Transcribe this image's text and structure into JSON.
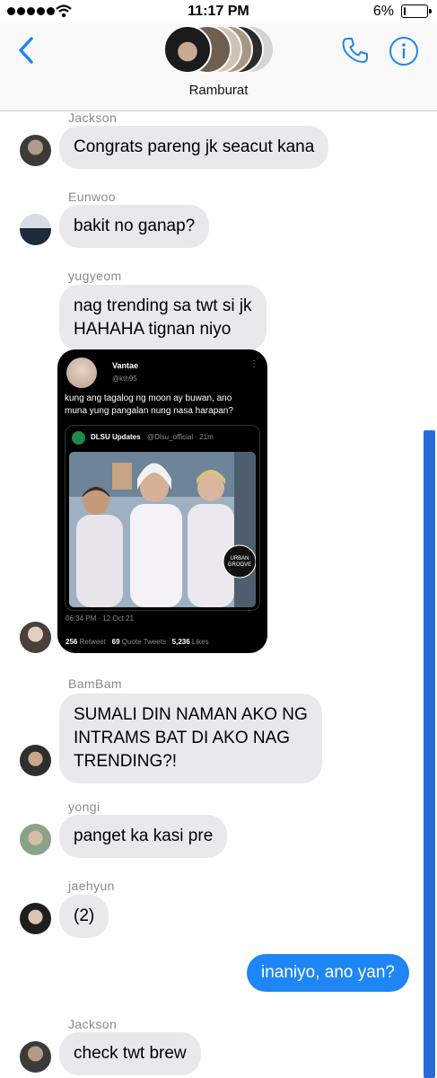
{
  "status": {
    "time": "11:17 PM",
    "battery": "6%",
    "battery_level": 0.06
  },
  "header": {
    "title": "Ramburat"
  },
  "messages": [
    {
      "sender": "Jackson",
      "text": "Congrats pareng jk seacut kana"
    },
    {
      "sender": "Eunwoo",
      "text": "bakit no ganap?"
    },
    {
      "sender": "yugyeom",
      "line1": "nag trending sa twt si jk",
      "line2": "HAHAHA tignan niyo"
    },
    {
      "sender": "BamBam",
      "line1": "SUMALI DIN NAMAN AKO NG",
      "line2": "INTRAMS BAT DI AKO NAG",
      "line3": "TRENDING?!"
    },
    {
      "sender": "yongi",
      "text": "panget ka kasi pre"
    },
    {
      "sender": "jaehyun",
      "text": "(2)"
    },
    {
      "sender": "me",
      "text": "inaniyo, ano yan?"
    },
    {
      "sender": "Jackson",
      "text": "check twt brew"
    }
  ],
  "tweet": {
    "name": "Vantae",
    "handle": "@kth95",
    "more": "⋮",
    "text_line1": "kung ang tagalog ng moon ay buwan, ano",
    "text_line2": "muna yung pangalan nung nasa harapan?",
    "quote_name": "DLSU Updates",
    "quote_handle": "@Dlsu_official · 21m",
    "badge_line1": "URBAN",
    "badge_line2": "GROOVE",
    "timestamp": "06:34 PM · 12 Oct 21",
    "retweets": "256",
    "retweets_label": "Retweet",
    "quotes": "69",
    "quotes_label": "Quote Tweets",
    "likes": "5,236",
    "likes_label": "Likes"
  },
  "colors": {
    "accent": "#1e86f5",
    "bubble": "#e9e9ed",
    "scroll": "#2a6ad8"
  }
}
